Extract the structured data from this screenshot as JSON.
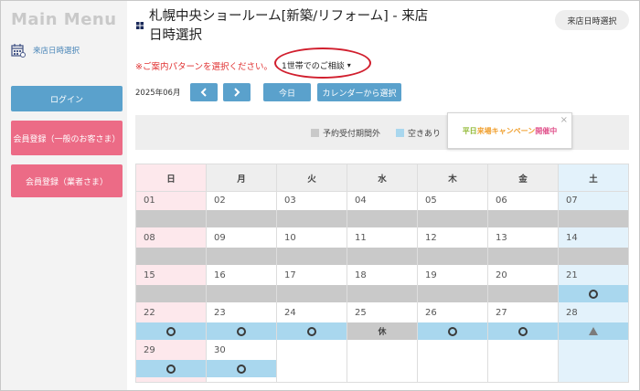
{
  "sidebar": {
    "title": "Main Menu",
    "reserve_link": "来店日時選択",
    "login": "ログイン",
    "member_register": "会員登録（一般のお客さま）",
    "business_register": "会員登録（業者さま）"
  },
  "header": {
    "title": "札幌中央ショールーム[新築/リフォーム] - 来店日時選択",
    "badge": "来店日時選択"
  },
  "pattern": {
    "prompt": "※ご案内パターンを選択ください。",
    "selected": "1世帯でのご相談"
  },
  "nav": {
    "month": "2025年06月",
    "today": "今日",
    "pick_calendar": "カレンダーから選択"
  },
  "legend": {
    "outside": "予約受付期間外",
    "available": "空きあり"
  },
  "campaign": {
    "part1": "平日",
    "part2": "来場キャンペーン",
    "part3": "開催中",
    "close": "×"
  },
  "colors": {
    "accent_blue": "#5aa1cc",
    "accent_pink": "#ec6b86",
    "available": "#a9d7ee",
    "outside": "#c9c9c9"
  },
  "calendar": {
    "weekdays": [
      "日",
      "月",
      "火",
      "水",
      "木",
      "金",
      "土"
    ],
    "weeks": [
      [
        {
          "d": "01",
          "s": "gray"
        },
        {
          "d": "02",
          "s": "gray"
        },
        {
          "d": "03",
          "s": "gray"
        },
        {
          "d": "04",
          "s": "gray"
        },
        {
          "d": "05",
          "s": "gray"
        },
        {
          "d": "06",
          "s": "gray"
        },
        {
          "d": "07",
          "s": "gray"
        }
      ],
      [
        {
          "d": "08",
          "s": "gray"
        },
        {
          "d": "09",
          "s": "gray"
        },
        {
          "d": "10",
          "s": "gray"
        },
        {
          "d": "11",
          "s": "gray"
        },
        {
          "d": "12",
          "s": "gray"
        },
        {
          "d": "13",
          "s": "gray"
        },
        {
          "d": "14",
          "s": "gray"
        }
      ],
      [
        {
          "d": "15",
          "s": "gray"
        },
        {
          "d": "16",
          "s": "gray"
        },
        {
          "d": "17",
          "s": "gray"
        },
        {
          "d": "18",
          "s": "gray"
        },
        {
          "d": "19",
          "s": "gray"
        },
        {
          "d": "20",
          "s": "gray"
        },
        {
          "d": "21",
          "s": "blue",
          "m": "circle"
        }
      ],
      [
        {
          "d": "22",
          "s": "blue",
          "m": "circle"
        },
        {
          "d": "23",
          "s": "blue",
          "m": "circle"
        },
        {
          "d": "24",
          "s": "blue",
          "m": "circle"
        },
        {
          "d": "25",
          "s": "hol",
          "t": "休"
        },
        {
          "d": "26",
          "s": "blue",
          "m": "circle"
        },
        {
          "d": "27",
          "s": "blue",
          "m": "circle"
        },
        {
          "d": "28",
          "s": "blue",
          "m": "triangle"
        }
      ],
      [
        {
          "d": "29",
          "s": "blue",
          "m": "circle"
        },
        {
          "d": "30",
          "s": "blue",
          "m": "circle"
        },
        {
          "d": "",
          "s": "none"
        },
        {
          "d": "",
          "s": "none"
        },
        {
          "d": "",
          "s": "none"
        },
        {
          "d": "",
          "s": "none"
        },
        {
          "d": "",
          "s": "none"
        }
      ]
    ]
  }
}
